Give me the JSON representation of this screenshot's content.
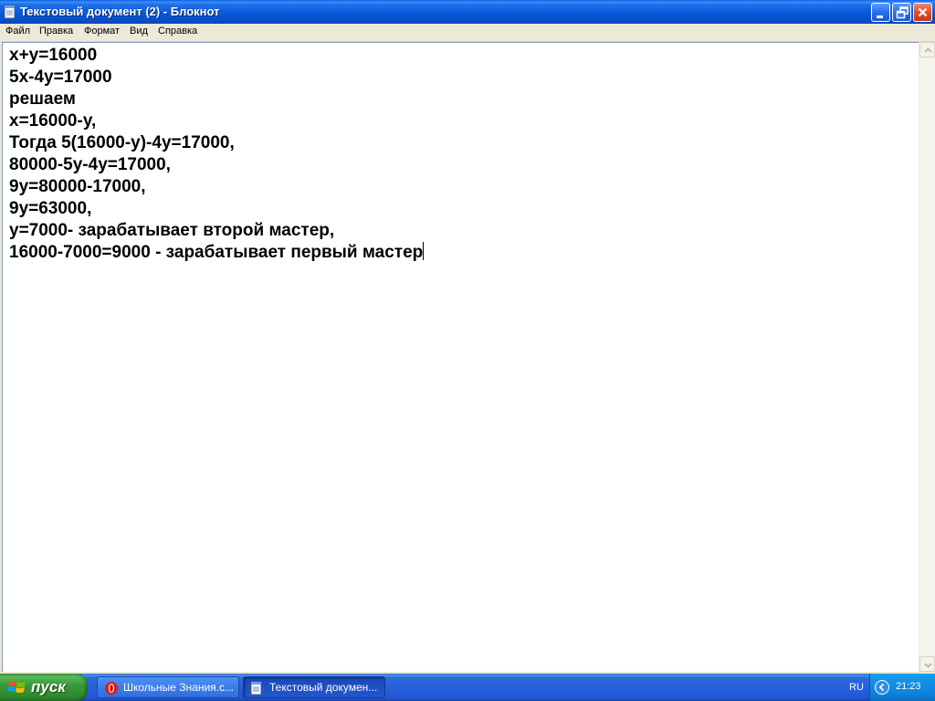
{
  "window": {
    "title": "Текстовый документ (2) - Блокнот",
    "icon": "notepad-icon",
    "controls": {
      "minimize_icon": "minimize-icon",
      "maximize_icon": "restore-icon",
      "close_icon": "close-icon"
    }
  },
  "menu": {
    "items": [
      {
        "label": "Файл"
      },
      {
        "label": "Правка"
      },
      {
        "label": "Формат"
      },
      {
        "label": "Вид"
      },
      {
        "label": "Справка"
      }
    ]
  },
  "document": {
    "lines": [
      "x+y=16000",
      "5x-4y=17000",
      "решаем",
      "x=16000-y,",
      "Тогда 5(16000-y)-4y=17000,",
      "80000-5y-4y=17000,",
      "9y=80000-17000,",
      "9y=63000,",
      "y=7000- зарабатывает второй мастер,",
      "16000-7000=9000 - зарабатывает первый мастер"
    ]
  },
  "taskbar": {
    "start_label": "пуск",
    "tasks": [
      {
        "label": "Школьные Знания.c...",
        "icon": "opera-icon",
        "active": false
      },
      {
        "label": "Текстовый докумен...",
        "icon": "notepad-icon",
        "active": true
      }
    ],
    "language": "RU",
    "clock": "21:23"
  },
  "colors": {
    "titlebar": "#0858d8",
    "taskbar": "#245edb",
    "start_button": "#3a9a3a",
    "tray": "#0f84de",
    "close_button": "#d9512e"
  }
}
